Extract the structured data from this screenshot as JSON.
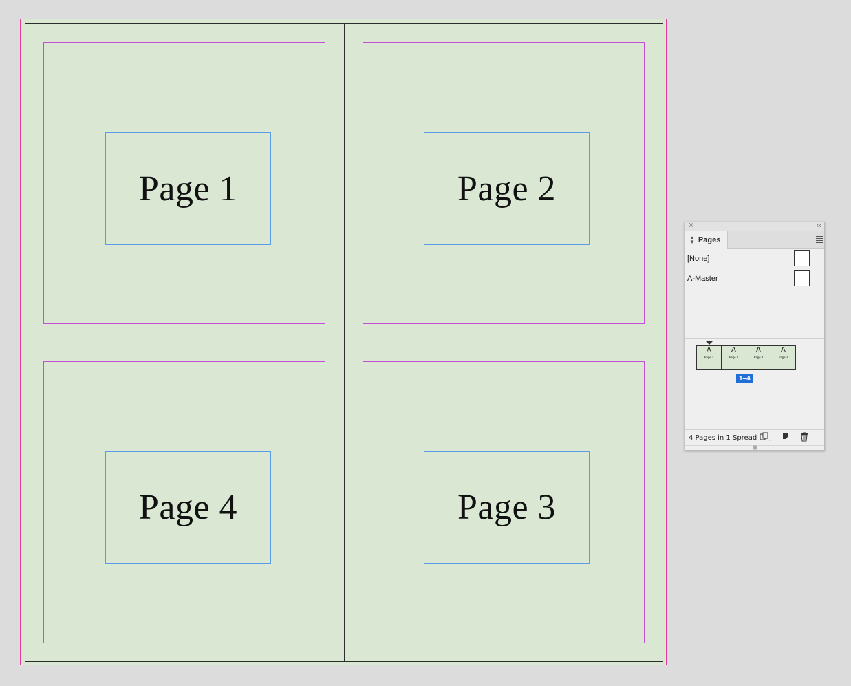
{
  "document": {
    "pages": [
      {
        "label": "Page 1"
      },
      {
        "label": "Page 2"
      },
      {
        "label": "Page 4"
      },
      {
        "label": "Page 3"
      }
    ]
  },
  "pages_panel": {
    "tab_label": "Pages",
    "masters": [
      {
        "name": "[None]"
      },
      {
        "name": "A-Master"
      }
    ],
    "spread": {
      "pages": [
        {
          "master": "A"
        },
        {
          "master": "A"
        },
        {
          "master": "A"
        },
        {
          "master": "A"
        }
      ],
      "label": "1–4"
    },
    "status": "4 Pages in 1 Spread",
    "icons": {
      "close": "close-icon",
      "collapse": "collapse-icon",
      "menu": "panel-menu-icon",
      "edit_page_size": "edit-page-size-icon",
      "new_page": "new-page-icon",
      "delete": "trash-icon"
    }
  },
  "colors": {
    "page_fill": "#d9e7d3",
    "bleed_guide": "#e23b9a",
    "margin_guide": "#c54fd8",
    "frame_edge": "#5b9bea",
    "selection": "#1f6fd6"
  }
}
